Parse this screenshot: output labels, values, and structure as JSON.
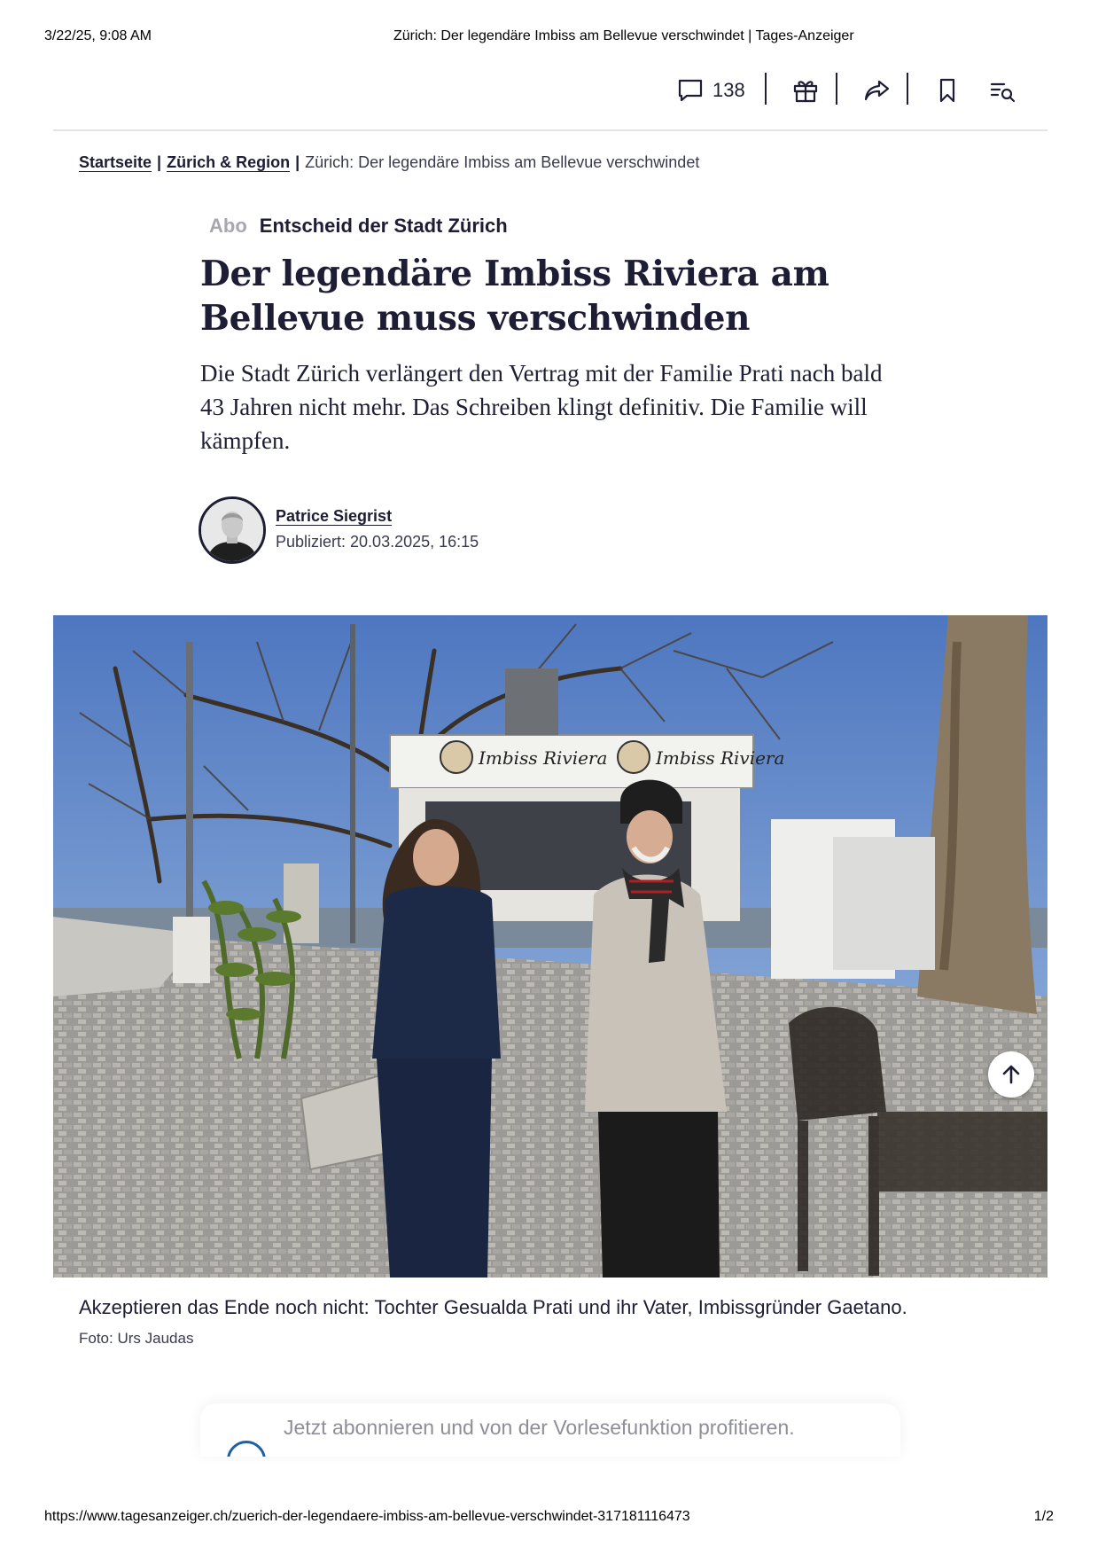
{
  "print_header": {
    "date": "3/22/25, 9:08 AM",
    "title": "Zürich: Der legendäre Imbiss am Bellevue verschwindet | Tages-Anzeiger"
  },
  "toolbar": {
    "comment_count": "138",
    "icons": [
      "comment-icon",
      "gift-icon",
      "share-icon",
      "bookmark-icon",
      "reading-list-icon"
    ]
  },
  "breadcrumb": {
    "home": "Startseite",
    "section": "Zürich & Region",
    "current": "Zürich: Der legendäre Imbiss am Bellevue verschwindet",
    "separator": "|"
  },
  "article": {
    "abo_label": "Abo",
    "kicker": "Entscheid der Stadt Zürich",
    "headline": "Der legendäre Imbiss Riviera am Bellevue muss verschwinden",
    "lead": "Die Stadt Zürich verlängert den Vertrag mit der Familie Prati nach bald 43 Jahren nicht mehr. Das Schreiben klingt definitiv. Die Familie will kämpfen.",
    "author": "Patrice Siegrist",
    "published": "Publiziert: 20.03.2025, 16:15"
  },
  "image": {
    "sign_text": "Imbiss Riviera",
    "caption": "Akzeptieren das Ende noch nicht: Tochter Gesualda Prati und ihr Vater, Imbissgründer Gaetano.",
    "credit": "Foto: Urs Jaudas"
  },
  "audio_promo": {
    "text": "Jetzt abonnieren und von der Vorlesefunktion profitieren."
  },
  "print_footer": {
    "url": "https://www.tagesanzeiger.ch/zuerich-der-legendaere-imbiss-am-bellevue-verschwindet-317181116473",
    "page": "1/2"
  },
  "colors": {
    "text": "#1d1d35",
    "muted": "#a7a7b0",
    "divider": "#e3e3e6",
    "audio_accent": "#1f5fa5"
  }
}
